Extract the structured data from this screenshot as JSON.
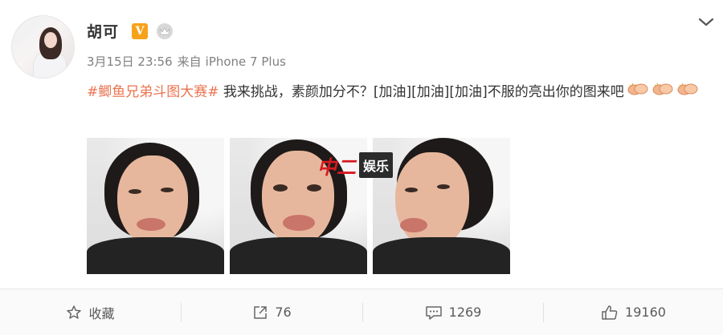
{
  "post": {
    "author": "胡可",
    "verified_badge": "V",
    "timestamp": "3月15日 23:56",
    "source_prefix": "来自",
    "source": "iPhone 7 Plus",
    "hashtag": "#鲫鱼兄弟斗图大赛#",
    "body_text": " 我来挑战，素颜加分不？[加油][加油][加油]不服的亮出你的图来吧",
    "emoji_icons": [
      "clap-icon",
      "clap-icon",
      "clap-icon"
    ]
  },
  "watermark": {
    "logo": "中二",
    "label": "娱乐"
  },
  "actions": {
    "favorite": "收藏",
    "repost_count": "76",
    "comment_count": "1269",
    "like_count": "19160"
  },
  "colors": {
    "hashtag": "#eb7350",
    "badge": "#f7a21b",
    "watermark_red": "#d71920"
  }
}
